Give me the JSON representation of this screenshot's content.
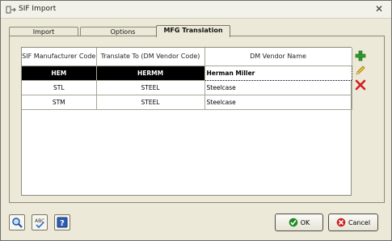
{
  "window": {
    "title": "SIF Import"
  },
  "tabs": [
    {
      "label": "Import"
    },
    {
      "label": "Options"
    },
    {
      "label": "MFG Translation"
    }
  ],
  "table": {
    "columns": [
      "SIF Manufacturer Code",
      "Translate To (DM Vendor Code)",
      "DM Vendor Name"
    ],
    "rows": [
      [
        "HEM",
        "HERMM",
        "Herman Miller"
      ],
      [
        "STL",
        "STEEL",
        "Steelcase"
      ],
      [
        "STM",
        "STEEL",
        "Steelcase"
      ]
    ],
    "selected_row": 0
  },
  "side_buttons": {
    "add_icon": "plus-icon",
    "edit_icon": "pencil-icon",
    "delete_icon": "red-x-icon"
  },
  "bottom_buttons": {
    "ok_label": "OK",
    "cancel_label": "Cancel",
    "search_icon": "magnifier-icon",
    "spellcheck_icon": "spellcheck-icon",
    "help_icon": "help-icon"
  },
  "colors": {
    "selection_bg": "#000000",
    "selection_fg": "#ffffff",
    "add_green": "#2e9b2e",
    "delete_red": "#d21e1e",
    "ok_green": "#1f8a1f",
    "cancel_red": "#cc2020"
  }
}
